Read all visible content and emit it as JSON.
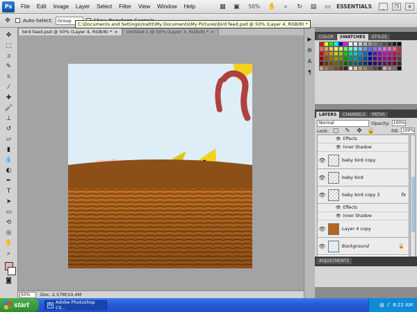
{
  "menubar": {
    "items": [
      "File",
      "Edit",
      "Image",
      "Layer",
      "Select",
      "Filter",
      "View",
      "Window",
      "Help"
    ],
    "zoom": "50%",
    "workspace": "ESSENTIALS"
  },
  "options": {
    "auto_select_label": "Auto-Select:",
    "auto_select_value": "Group",
    "show_transform_label": "Show Transform Controls",
    "tooltip": "C:\\Documents and Settings\\mattt\\My Documents\\My Pictures\\bird feed.psd @ 50% (Layer 4, RGB/8) *"
  },
  "documents": {
    "tabs": [
      {
        "label": "bird feed.psd @ 50% (Layer 4, RGB/8) *",
        "close": "×"
      },
      {
        "label": "Untitled-1 @ 50% (Layer 3, RGB/8) *",
        "close": "×"
      }
    ]
  },
  "status": {
    "zoom": "50%",
    "doc": "Doc: 2.57M/10.4M"
  },
  "swatches_panel": {
    "tabs": [
      "COLOR",
      "SWATCHES",
      "STYLES"
    ],
    "colors": [
      "#ff0000",
      "#ffff00",
      "#00ff00",
      "#00ffff",
      "#0000ff",
      "#ff00ff",
      "#ffffff",
      "#e6e6e6",
      "#cccccc",
      "#b3b3b3",
      "#999999",
      "#808080",
      "#666666",
      "#4d4d4d",
      "#333333",
      "#1a1a1a",
      "#000000",
      "#ff6666",
      "#ff9966",
      "#ffcc66",
      "#ffff66",
      "#ccff66",
      "#66ff66",
      "#66ffcc",
      "#66ffff",
      "#66ccff",
      "#6699ff",
      "#6666ff",
      "#9966ff",
      "#cc66ff",
      "#ff66ff",
      "#ff66cc",
      "#ff6699",
      "#cc3333",
      "#cc0000",
      "#cc6600",
      "#cc9900",
      "#cccc00",
      "#99cc00",
      "#00cc00",
      "#00cc99",
      "#00cccc",
      "#0099cc",
      "#0066cc",
      "#0000cc",
      "#6600cc",
      "#9900cc",
      "#cc00cc",
      "#cc0099",
      "#cc0066",
      "#993333",
      "#990000",
      "#994c00",
      "#997300",
      "#999900",
      "#739900",
      "#009900",
      "#009973",
      "#009999",
      "#007399",
      "#004c99",
      "#000099",
      "#4c0099",
      "#730099",
      "#990099",
      "#990073",
      "#99004c",
      "#663333",
      "#660000",
      "#663300",
      "#664d00",
      "#666600",
      "#4d6600",
      "#006600",
      "#00664d",
      "#006666",
      "#004d66",
      "#003366",
      "#000066",
      "#330066",
      "#4d0066",
      "#660066",
      "#66004d",
      "#660033",
      "#332222",
      "#c8a27a",
      "#a67c52",
      "#8c6239",
      "#754c24",
      "#603913",
      "#3c2415",
      "#f7e3c0",
      "#e0c49a",
      "#c69c6d",
      "#998675",
      "#736357",
      "#534741",
      "#362f2d",
      "#c7b299",
      "#a59380",
      "#827464",
      "#000000"
    ]
  },
  "layers_panel": {
    "tabs": [
      "LAYERS",
      "CHANNELS",
      "PATHS"
    ],
    "blend_mode": "Normal",
    "opacity_label": "Opacity:",
    "opacity": "100%",
    "lock_label": "Lock:",
    "fill_label": "Fill:",
    "fill": "100%",
    "rows": [
      {
        "kind": "effect",
        "label": "Effects"
      },
      {
        "kind": "effect",
        "label": "Inner Shadow"
      },
      {
        "kind": "layer",
        "name": "baby bird copy"
      },
      {
        "kind": "layer",
        "name": "baby bird"
      },
      {
        "kind": "layer",
        "name": "baby bird copy 3",
        "fx": "fx"
      },
      {
        "kind": "effect",
        "label": "Effects"
      },
      {
        "kind": "effect",
        "label": "Inner Shadow"
      },
      {
        "kind": "layer",
        "name": "Layer 4 copy"
      },
      {
        "kind": "layer",
        "name": "Background",
        "italic": true
      }
    ]
  },
  "adjustments_panel": {
    "tab": "ADJUSTMENTS"
  },
  "taskbar": {
    "start": "start",
    "task": "Adobe Photoshop CS...",
    "clock": "8:22 AM"
  },
  "colors": {
    "sky": "#ddeef7",
    "nest": "#b5651d",
    "bird_brown": "#8a5a1f",
    "beak_yellow": "#f2d21f",
    "worm": "#b0413e",
    "pink_bird": "#f6c7c9"
  }
}
